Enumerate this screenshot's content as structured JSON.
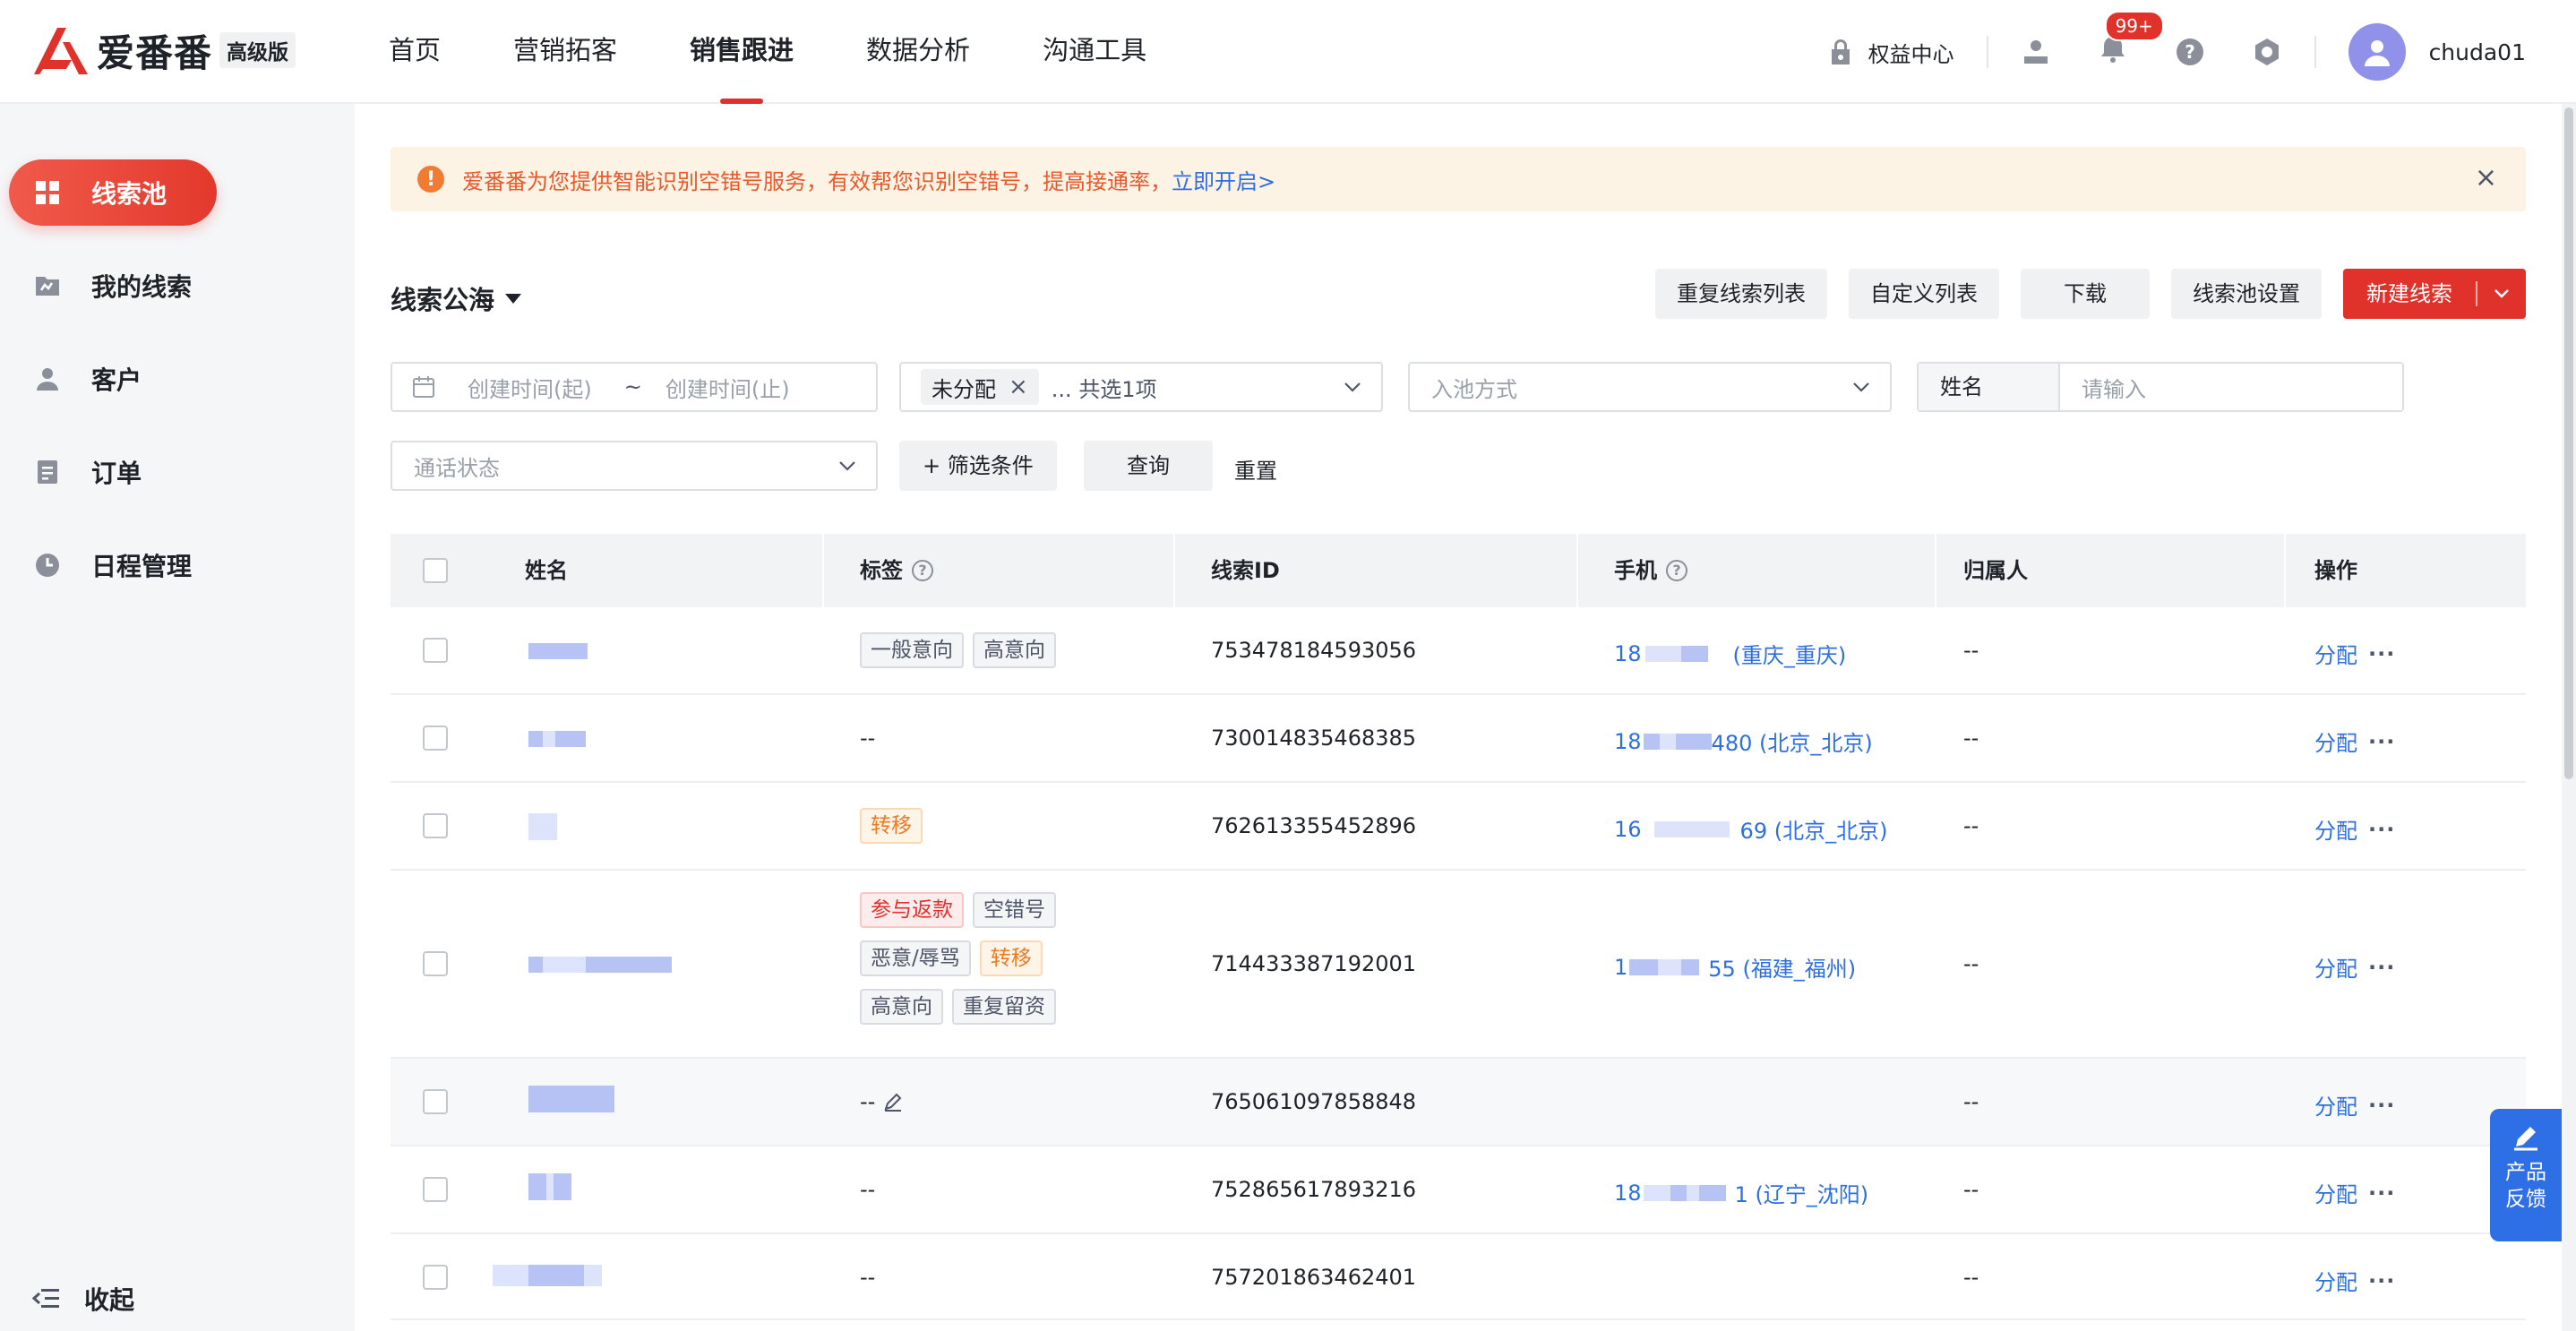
{
  "brand": {
    "name": "爱番番",
    "edition": "高级版"
  },
  "nav": [
    {
      "label": "首页",
      "active": false
    },
    {
      "label": "营销拓客",
      "active": false
    },
    {
      "label": "销售跟进",
      "active": true
    },
    {
      "label": "数据分析",
      "active": false
    },
    {
      "label": "沟通工具",
      "active": false
    }
  ],
  "header_right": {
    "rights_center": "权益中心",
    "notify_count": "99+",
    "username": "chuda01"
  },
  "sidebar": {
    "items": [
      {
        "label": "线索池",
        "icon": "grid-icon",
        "active": true
      },
      {
        "label": "我的线索",
        "icon": "folder-icon",
        "active": false
      },
      {
        "label": "客户",
        "icon": "user-icon",
        "active": false
      },
      {
        "label": "订单",
        "icon": "document-icon",
        "active": false
      },
      {
        "label": "日程管理",
        "icon": "clock-icon",
        "active": false
      }
    ],
    "collapse_label": "收起"
  },
  "notice": {
    "text": "爱番番为您提供智能识别空错号服务，有效帮您识别空错号，提高接通率，",
    "link": "立即开启>"
  },
  "pool": {
    "title": "线索公海",
    "buttons": [
      "重复线索列表",
      "自定义列表",
      "下载",
      "线索池设置"
    ],
    "primary": "新建线索"
  },
  "filters": {
    "date_start_placeholder": "创建时间(起)",
    "date_sep": "~",
    "date_end_placeholder": "创建时间(止)",
    "assign_chip": "未分配",
    "assign_summary": "... 共选1项",
    "pool_method_placeholder": "入池方式",
    "name_label": "姓名",
    "name_placeholder": "请输入",
    "call_status_placeholder": "通话状态",
    "more_filters": "+ 筛选条件",
    "query": "查询",
    "reset": "重置"
  },
  "table": {
    "columns": {
      "name": "姓名",
      "tags": "标签",
      "lead_id": "线索ID",
      "mobile": "手机",
      "owner": "归属人",
      "ops": "操作"
    },
    "op_assign": "分配",
    "op_more": "···",
    "rows": [
      {
        "tags": [
          {
            "t": "一般意向",
            "c": "gray"
          },
          {
            "t": "高意向",
            "c": "gray"
          }
        ],
        "tags_empty": "",
        "lead_id": "753478184593056",
        "phone_prefix": "18",
        "phone_suffix": "(重庆_重庆)",
        "owner": "--"
      },
      {
        "tags": [],
        "tags_empty": "--",
        "lead_id": "730014835468385",
        "phone_prefix": "18",
        "phone_suffix": "480 (北京_北京)",
        "owner": "--"
      },
      {
        "tags": [
          {
            "t": "转移",
            "c": "orange"
          }
        ],
        "tags_empty": "",
        "lead_id": "762613355452896",
        "phone_prefix": "16",
        "phone_suffix": "69 (北京_北京)",
        "owner": "--"
      },
      {
        "tags": [
          {
            "t": "参与返款",
            "c": "red"
          },
          {
            "t": "空错号",
            "c": "gray"
          },
          {
            "t": "恶意/辱骂",
            "c": "gray"
          },
          {
            "t": "转移",
            "c": "orange"
          },
          {
            "t": "高意向",
            "c": "gray"
          },
          {
            "t": "重复留资",
            "c": "gray"
          }
        ],
        "tags_empty": "",
        "lead_id": "714433387192001",
        "phone_prefix": "1",
        "phone_suffix": "55 (福建_福州)",
        "owner": "--"
      },
      {
        "tags": [],
        "tags_empty": "--",
        "lead_id": "765061097858848",
        "phone_prefix": "",
        "phone_suffix": "",
        "owner": "--"
      },
      {
        "tags": [],
        "tags_empty": "--",
        "lead_id": "752865617893216",
        "phone_prefix": "18",
        "phone_suffix": "1 (辽宁_沈阳)",
        "owner": "--"
      },
      {
        "tags": [],
        "tags_empty": "--",
        "lead_id": "757201863462401",
        "phone_prefix": "",
        "phone_suffix": "",
        "owner": "--"
      }
    ]
  },
  "feedback": {
    "line1": "产品",
    "line2": "反馈"
  },
  "colors": {
    "accent": "#e0312b",
    "link": "#2d6fe0",
    "notice_bg": "#fdf3e4"
  }
}
